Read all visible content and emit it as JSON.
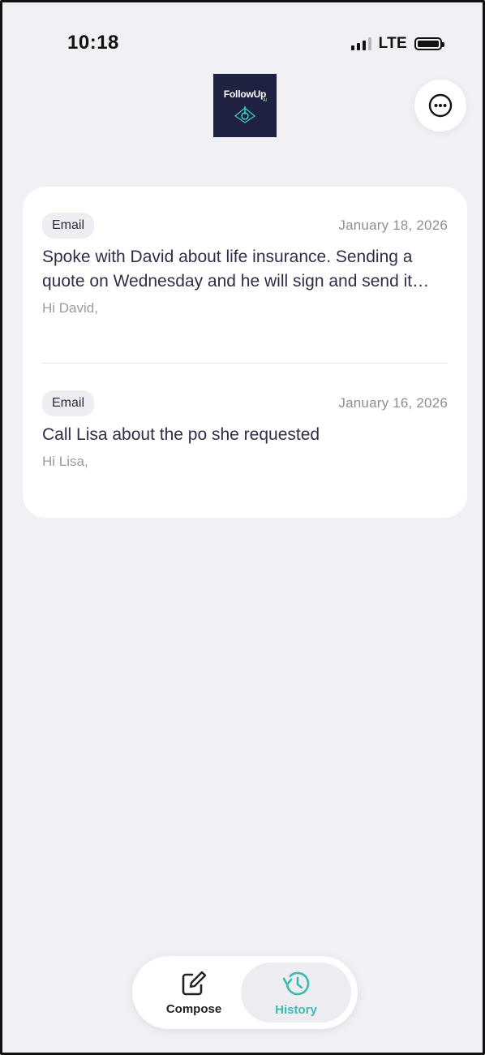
{
  "status_bar": {
    "time": "10:18",
    "network": "LTE"
  },
  "header": {
    "logo_text": "FollowUp",
    "logo_sub": "AI",
    "more_icon": "more-horizontal-icon"
  },
  "history": {
    "items": [
      {
        "type": "Email",
        "date": "January 18, 2026",
        "subject": "Spoke with David about life insurance. Sending a quote on Wednesday and he will sign and send it back",
        "preview": "Hi David,"
      },
      {
        "type": "Email",
        "date": "January 16, 2026",
        "subject": "Call Lisa about the po she requested",
        "preview": "Hi Lisa,"
      }
    ]
  },
  "tabbar": {
    "compose_label": "Compose",
    "compose_icon": "compose-icon",
    "history_label": "History",
    "history_icon": "history-icon",
    "active_tab": "History",
    "accent_color": "#3bbcb0"
  },
  "colors": {
    "background": "#f1f0f5",
    "card": "#ffffff",
    "logo_bg": "#1f2140"
  }
}
